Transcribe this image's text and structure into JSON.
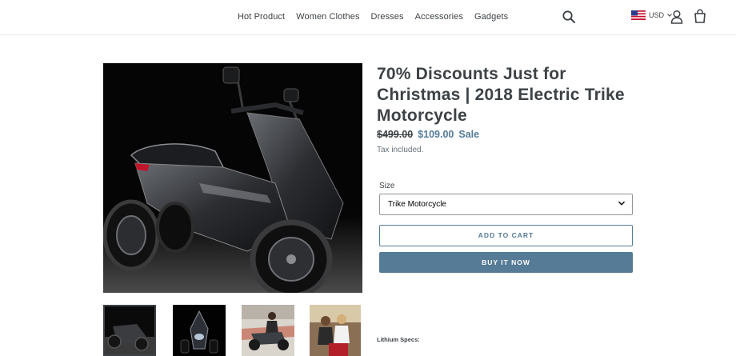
{
  "nav": {
    "items": [
      "Hot Product",
      "Women Clothes",
      "Dresses",
      "Accessories",
      "Gadgets"
    ]
  },
  "header": {
    "currency": "USD",
    "icons": [
      "search-icon",
      "us-flag-icon",
      "account-icon",
      "cart-icon"
    ]
  },
  "product": {
    "title": "70% Discounts Just for Christmas | 2018 Electric Trike Motorcycle",
    "price_old": "$499.00",
    "price_new": "$109.00",
    "sale_label": "Sale",
    "tax_note": "Tax included.",
    "size_label": "Size",
    "size_selected": "Trike Motorcycle",
    "add_to_cart": "ADD TO CART",
    "buy_now": "BUY IT NOW",
    "specs_heading": "Lithium Specs:"
  },
  "colors": {
    "accent": "#557b97",
    "text": "#3d4246",
    "muted": "#69727b"
  }
}
